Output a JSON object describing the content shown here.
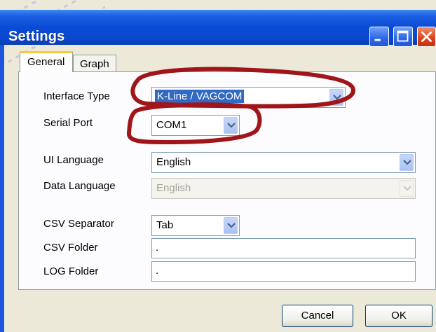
{
  "window": {
    "title": "Settings",
    "controls": [
      "minimize-icon",
      "maximize-icon",
      "close-icon"
    ]
  },
  "tabs": [
    {
      "label": "General",
      "active": true
    },
    {
      "label": "Graph",
      "active": false
    }
  ],
  "form": {
    "interface_type": {
      "label": "Interface Type",
      "value": "K-Line / VAGCOM"
    },
    "serial_port": {
      "label": "Serial Port",
      "value": "COM1"
    },
    "ui_language": {
      "label": "UI Language",
      "value": "English"
    },
    "data_language": {
      "label": "Data Language",
      "value": "English",
      "disabled": true
    },
    "csv_separator": {
      "label": "CSV Separator",
      "value": "Tab"
    },
    "csv_folder": {
      "label": "CSV Folder",
      "value": "."
    },
    "log_folder": {
      "label": "LOG Folder",
      "value": "."
    }
  },
  "buttons": {
    "cancel": "Cancel",
    "ok": "OK"
  },
  "colors": {
    "titlebar": "#0a4bd6",
    "selection": "#316ac5",
    "annotation": "#a0151a",
    "dialog_face": "#ece9d8"
  }
}
